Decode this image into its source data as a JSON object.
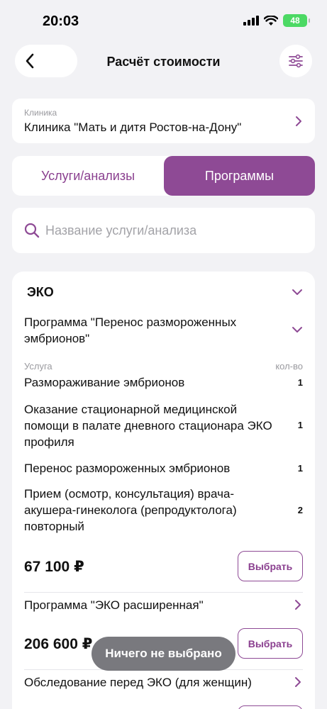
{
  "status_bar": {
    "time": "20:03",
    "battery": "48"
  },
  "nav": {
    "title": "Расчёт стоимости"
  },
  "clinic": {
    "label": "Клиника",
    "value": "Клиника \"Мать и дитя Ростов-на-Дону\""
  },
  "tabs": {
    "services": "Услуги/анализы",
    "programs": "Программы"
  },
  "search": {
    "placeholder": "Название услуги/анализа",
    "value": ""
  },
  "section": {
    "title": "ЭКО",
    "program1": {
      "title": "Программа \"Перенос размороженных эмбрионов\"",
      "col_service": "Услуга",
      "col_qty": "кол-во",
      "rows": [
        {
          "name": "Размораживание эмбрионов",
          "qty": "1"
        },
        {
          "name": "Оказание стационарной медицинской помощи в палате дневного стационара ЭКО профиля",
          "qty": "1"
        },
        {
          "name": "Перенос размороженных эмбрионов",
          "qty": "1"
        },
        {
          "name": "Прием (осмотр, консультация) врача-акушера-гинеколога (репродуктолога) повторный",
          "qty": "2"
        }
      ],
      "price": "67 100 ₽",
      "select_label": "Выбрать"
    },
    "program2": {
      "title": "Программа \"ЭКО расширенная\"",
      "price": "206 600 ₽",
      "select_label": "Выбрать"
    },
    "program3": {
      "title": "Обследование перед ЭКО (для женщин)"
    }
  },
  "toast": {
    "text": "Ничего не выбрано"
  },
  "colors": {
    "accent": "#8e4a95",
    "background": "#f2f2f5",
    "battery": "#4cd964"
  }
}
